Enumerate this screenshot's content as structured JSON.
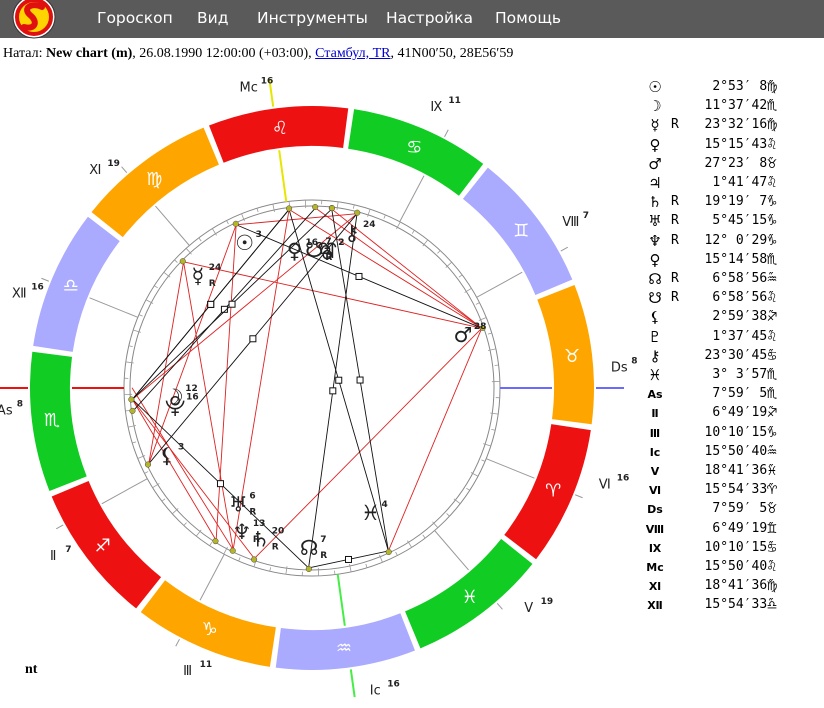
{
  "menu": [
    "Гороскоп",
    "Вид",
    "Инструменты",
    "Настройка",
    "Помощь"
  ],
  "info": {
    "prefix": "Натал: ",
    "name": "New chart (m)",
    "datetime": ", 26.08.1990 12:00:00 (+03:00), ",
    "place": "Стамбул, TR",
    "coords": ", 41N00′50, 28E56′59"
  },
  "footer_text": "nt",
  "colors": {
    "fire": "#ee1111",
    "earth": "#ffa500",
    "air": "#aaaaff",
    "water": "#11cc22",
    "aspect_hard": "#dd2222",
    "aspect_soft": "#111111"
  },
  "chart_data": {
    "type": "radial",
    "ascendant": "7°59′5″ ♏",
    "signs": [
      {
        "glyph": "♈",
        "element": "fire"
      },
      {
        "glyph": "♉",
        "element": "earth"
      },
      {
        "glyph": "♊",
        "element": "air"
      },
      {
        "glyph": "♋",
        "element": "water"
      },
      {
        "glyph": "♌",
        "element": "fire"
      },
      {
        "glyph": "♍",
        "element": "earth"
      },
      {
        "glyph": "♎",
        "element": "air"
      },
      {
        "glyph": "♏",
        "element": "water"
      },
      {
        "glyph": "♐",
        "element": "fire"
      },
      {
        "glyph": "♑",
        "element": "earth"
      },
      {
        "glyph": "♒",
        "element": "air"
      },
      {
        "glyph": "♓",
        "element": "water"
      }
    ],
    "houses": [
      {
        "label": "As",
        "deg": "8",
        "lon": 217.985
      },
      {
        "label": "Ⅱ",
        "deg": "7",
        "lon": 246.822
      },
      {
        "label": "Ⅲ",
        "deg": "11",
        "lon": 280.171
      },
      {
        "label": "Ic",
        "deg": "16",
        "lon": 315.844
      },
      {
        "label": "Ⅴ",
        "deg": "19",
        "lon": 348.693
      },
      {
        "label": "Ⅵ",
        "deg": "16",
        "lon": 15.909
      },
      {
        "label": "Ds",
        "deg": "8",
        "lon": 37.985
      },
      {
        "label": "Ⅷ",
        "deg": "7",
        "lon": 66.822
      },
      {
        "label": "Ⅸ",
        "deg": "11",
        "lon": 100.171
      },
      {
        "label": "Mc",
        "deg": "16",
        "lon": 135.844
      },
      {
        "label": "Ⅺ",
        "deg": "19",
        "lon": 168.693
      },
      {
        "label": "Ⅻ",
        "deg": "16",
        "lon": 195.909
      }
    ],
    "planets": [
      {
        "glyph": "☉",
        "deg": "3",
        "lon": 152.886,
        "retro": false
      },
      {
        "glyph": "☽",
        "deg": "12",
        "lon": 221.628,
        "retro": false
      },
      {
        "glyph": "☿",
        "deg": "24",
        "lon": 173.538,
        "retro": true
      },
      {
        "glyph": "♀",
        "deg": "16",
        "lon": 135.262,
        "retro": false
      },
      {
        "glyph": "♂",
        "deg": "28",
        "lon": 57.39,
        "retro": false
      },
      {
        "glyph": "♃",
        "deg": "2",
        "lon": 121.696,
        "retro": false
      },
      {
        "glyph": "♄",
        "deg": "20",
        "lon": 289.319,
        "retro": true
      },
      {
        "glyph": "♅",
        "deg": "6",
        "lon": 275.754,
        "retro": true
      },
      {
        "glyph": "♆",
        "deg": "13",
        "lon": 282.008,
        "retro": true
      },
      {
        "glyph": "⯓",
        "deg": "16",
        "lon": 225.249,
        "retro": false
      },
      {
        "glyph": "☊",
        "deg": "7",
        "lon": 306.982,
        "retro": true
      },
      {
        "glyph": "☋",
        "deg": "7",
        "lon": 126.982,
        "retro": true
      },
      {
        "glyph": "⚸",
        "deg": "3",
        "lon": 242.994,
        "retro": false
      },
      {
        "glyph": "⯔",
        "deg": "2",
        "lon": 121.629,
        "retro": false
      },
      {
        "glyph": "⚷",
        "deg": "24",
        "lon": 113.513,
        "retro": false
      },
      {
        "glyph": "♓",
        "deg": "4",
        "lon": 333.066,
        "retro": false
      }
    ],
    "aspects_hard": [
      [
        152.9,
        113.5
      ],
      [
        152.9,
        275.8
      ],
      [
        135.3,
        57.4
      ],
      [
        121.7,
        57.4
      ],
      [
        126.9,
        57.4
      ],
      [
        57.4,
        289.3
      ],
      [
        173.5,
        242.9
      ],
      [
        173.5,
        57.4
      ],
      [
        135.3,
        282.0
      ],
      [
        221.6,
        275.8
      ],
      [
        221.6,
        289.3
      ],
      [
        221.6,
        113.5
      ],
      [
        217.9,
        282.0
      ],
      [
        152.9,
        242.9
      ],
      [
        333.1,
        57.4
      ],
      [
        173.5,
        282.0
      ]
    ],
    "aspects_soft": [
      [
        152.9,
        57.4
      ],
      [
        135.3,
        333.1
      ],
      [
        121.7,
        333.1
      ],
      [
        126.9,
        225.2
      ],
      [
        113.5,
        242.9
      ],
      [
        221.6,
        135.3
      ],
      [
        113.5,
        306.9
      ],
      [
        221.6,
        306.9
      ],
      [
        333.1,
        306.9
      ],
      [
        121.7,
        221.6
      ],
      [
        135.3,
        221.6
      ]
    ]
  },
  "table": [
    {
      "sym": "☉",
      "r": "",
      "val": "2°53′ 8″",
      "sign": "♍"
    },
    {
      "sym": "☽",
      "r": "",
      "val": "11°37′42″",
      "sign": "♏"
    },
    {
      "sym": "☿",
      "r": "R",
      "val": "23°32′16″",
      "sign": "♍"
    },
    {
      "sym": "♀",
      "r": "",
      "val": "15°15′43″",
      "sign": "♌"
    },
    {
      "sym": "♂",
      "r": "",
      "val": "27°23′ 8″",
      "sign": "♉"
    },
    {
      "sym": "♃",
      "r": "",
      "val": "1°41′47″",
      "sign": "♌"
    },
    {
      "sym": "♄",
      "r": "R",
      "val": "19°19′ 7″",
      "sign": "♑"
    },
    {
      "sym": "♅",
      "r": "R",
      "val": "5°45′15″",
      "sign": "♑"
    },
    {
      "sym": "♆",
      "r": "R",
      "val": "12° 0′29″",
      "sign": "♑"
    },
    {
      "sym": "♀",
      "r": "",
      "val": "15°14′58″",
      "sign": "♏"
    },
    {
      "sym": "☊",
      "r": "R",
      "val": "6°58′56″",
      "sign": "♒"
    },
    {
      "sym": "☋",
      "r": "R",
      "val": "6°58′56″",
      "sign": "♌"
    },
    {
      "sym": "⚸",
      "r": "",
      "val": "2°59′38″",
      "sign": "♐"
    },
    {
      "sym": "♇",
      "r": "",
      "val": "1°37′45″",
      "sign": "♌"
    },
    {
      "sym": "⚷",
      "r": "",
      "val": "23°30′45″",
      "sign": "♋"
    },
    {
      "sym": "♓",
      "r": "",
      "val": "3° 3′57″",
      "sign": "♏"
    },
    {
      "sym": "As",
      "r": "",
      "val": "7°59′ 5″",
      "sign": "♏"
    },
    {
      "sym": "Ⅱ",
      "r": "",
      "val": "6°49′19″",
      "sign": "♐"
    },
    {
      "sym": "Ⅲ",
      "r": "",
      "val": "10°10′15″",
      "sign": "♑"
    },
    {
      "sym": "Ic",
      "r": "",
      "val": "15°50′40″",
      "sign": "♒"
    },
    {
      "sym": "Ⅴ",
      "r": "",
      "val": "18°41′36″",
      "sign": "♓"
    },
    {
      "sym": "Ⅵ",
      "r": "",
      "val": "15°54′33″",
      "sign": "♈"
    },
    {
      "sym": "Ds",
      "r": "",
      "val": "7°59′ 5″",
      "sign": "♉"
    },
    {
      "sym": "Ⅷ",
      "r": "",
      "val": "6°49′19″",
      "sign": "♊"
    },
    {
      "sym": "Ⅸ",
      "r": "",
      "val": "10°10′15″",
      "sign": "♋"
    },
    {
      "sym": "Mc",
      "r": "",
      "val": "15°50′40″",
      "sign": "♌"
    },
    {
      "sym": "Ⅺ",
      "r": "",
      "val": "18°41′36″",
      "sign": "♍"
    },
    {
      "sym": "Ⅻ",
      "r": "",
      "val": "15°54′33″",
      "sign": "♎"
    }
  ]
}
